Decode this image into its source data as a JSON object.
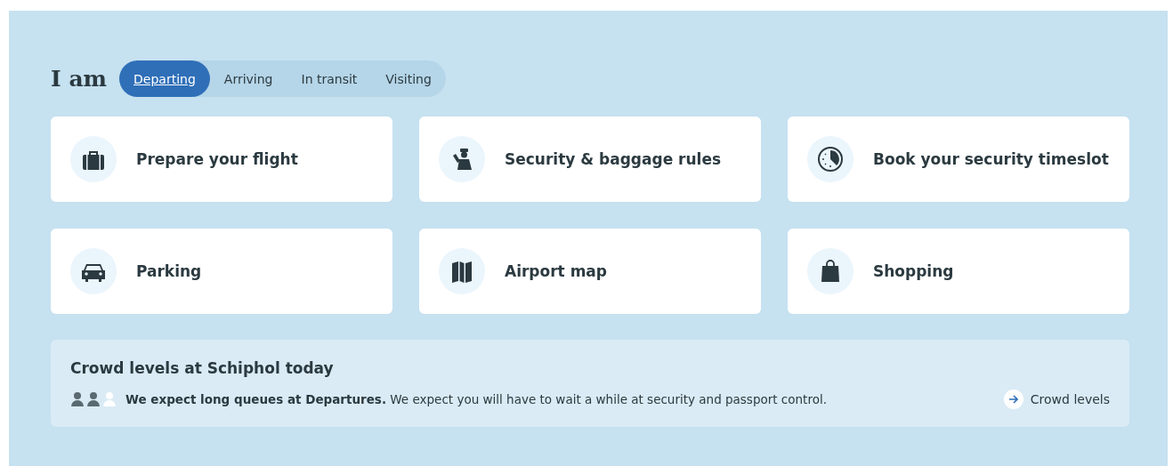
{
  "heading": "I am",
  "tabs": [
    {
      "label": "Departing",
      "selected": true
    },
    {
      "label": "Arriving",
      "selected": false
    },
    {
      "label": "In transit",
      "selected": false
    },
    {
      "label": "Visiting",
      "selected": false
    }
  ],
  "cards": [
    {
      "label": "Prepare your flight",
      "kind": "suitcase"
    },
    {
      "label": "Security & baggage rules",
      "kind": "officer"
    },
    {
      "label": "Book your security timeslot",
      "kind": "clock"
    },
    {
      "label": "Parking",
      "kind": "car"
    },
    {
      "label": "Airport map",
      "kind": "map"
    },
    {
      "label": "Shopping",
      "kind": "bag"
    }
  ],
  "crowd": {
    "title": "Crowd levels at Schiphol today",
    "people": [
      {
        "filled": true
      },
      {
        "filled": true
      },
      {
        "filled": false
      }
    ],
    "message": "**We expect long queues at Departures.** We expect you will have to wait a while at security and passport control.",
    "link": "Crowd levels"
  }
}
